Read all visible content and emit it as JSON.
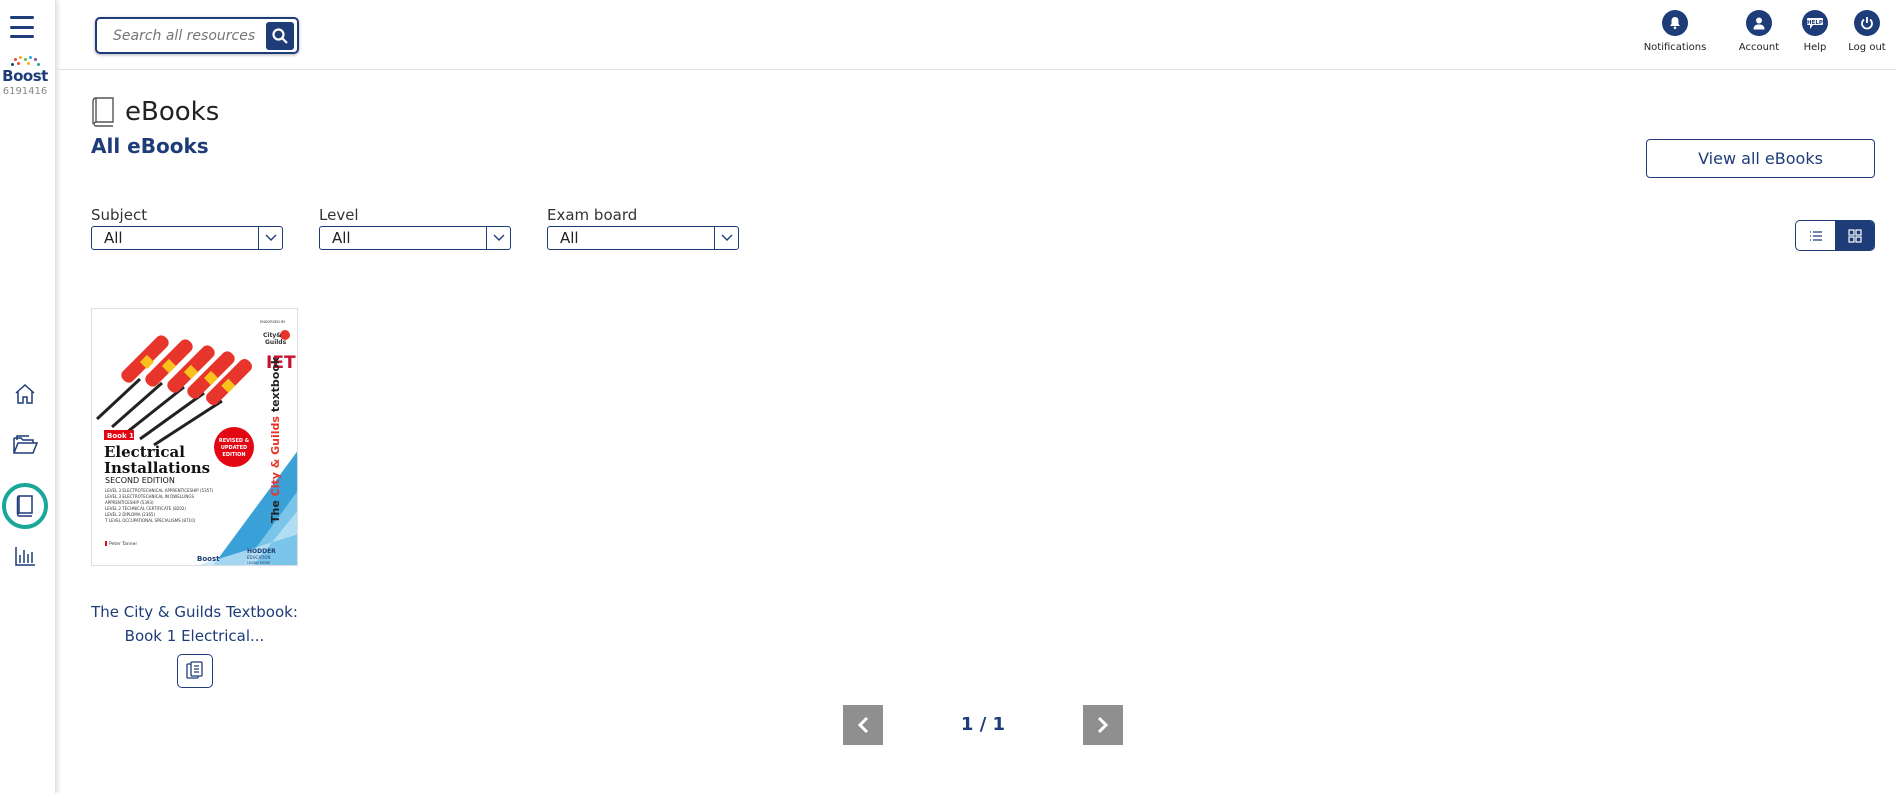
{
  "sidebar": {
    "logo_text": "Boost",
    "account_id": "6191416",
    "nav_items": [
      "home-icon",
      "folder-icon",
      "book-icon",
      "chart-icon"
    ],
    "active_item": "book-icon",
    "active_color": "#1aa79a"
  },
  "header": {
    "search_placeholder": "Search all resources",
    "actions": [
      {
        "icon": "bell-icon",
        "label": "Notifications"
      },
      {
        "icon": "user-icon",
        "label": "Account"
      },
      {
        "icon": "help-icon",
        "label": "Help"
      },
      {
        "icon": "power-icon",
        "label": "Log out"
      }
    ]
  },
  "page": {
    "title": "eBooks",
    "subtitle": "All eBooks",
    "view_all_label": "View all eBooks"
  },
  "filters": [
    {
      "label": "Subject",
      "value": "All"
    },
    {
      "label": "Level",
      "value": "All"
    },
    {
      "label": "Exam board",
      "value": "All"
    }
  ],
  "view_toggle": {
    "options": [
      "list-view-icon",
      "grid-view-icon"
    ],
    "selected": "grid-view-icon"
  },
  "books": [
    {
      "title_line1": "The City & Guilds Textbook:",
      "title_line2": "Book 1 Electrical...",
      "cover": {
        "badge": "Book 1",
        "heading_line1": "Electrical",
        "heading_line2": "Installations",
        "edition": "SECOND EDITION",
        "details": [
          "LEVEL 3 ELECTROTECHNICAL APPRENTICESHIP (5357)",
          "LEVEL 3 ELECTROTECHNICAL IN DWELLINGS",
          "APPRENTICESHIP (5393)",
          "LEVEL 2 TECHNICAL CERTIFICATE (8202)",
          "LEVEL 2 DIPLOMA (2365)",
          "T LEVEL OCCUPATIONAL SPECIALISMS (8710)"
        ],
        "author": "Peter Tanner",
        "spine_text_prefix": "The ",
        "spine_text_brand": "City & Guilds",
        "spine_text_suffix": " textbook",
        "sticker_lines": [
          "REVISED &",
          "UPDATED",
          "EDITION"
        ],
        "endorsed_text": "ENDORSED BY",
        "endorser": "City & Guilds",
        "iet_text": "IET",
        "boost_text": "Boost",
        "publisher_line1": "HODDER",
        "publisher_line2": "EDUCATION",
        "publisher_line3": "LEARN MORE"
      }
    }
  ],
  "pagination": {
    "text": "1 / 1"
  },
  "colors": {
    "brand": "#1d3c78",
    "accent": "#1aa79a",
    "pager": "#8f8f8f"
  }
}
